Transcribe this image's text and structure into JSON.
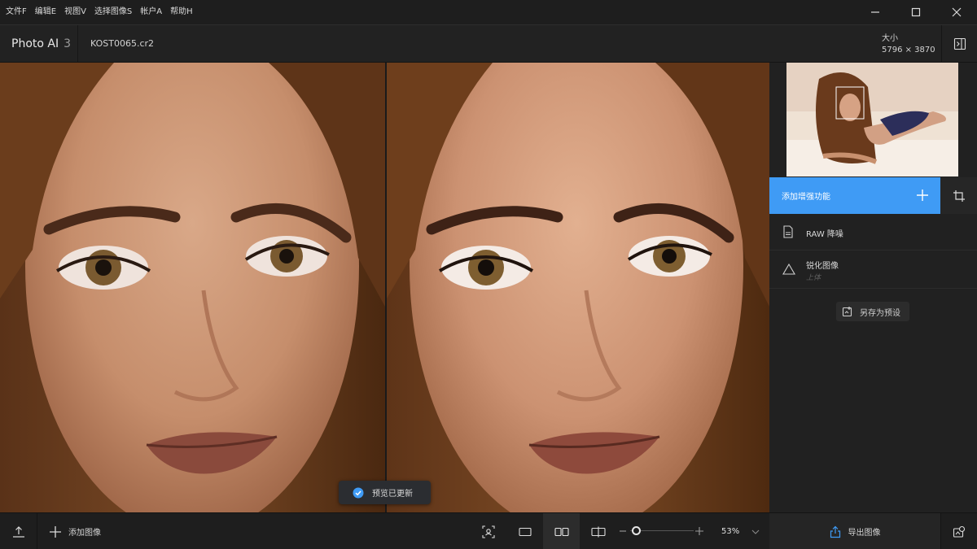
{
  "menu": {
    "items": [
      "文件F",
      "编辑E",
      "视图V",
      "选择图像S",
      "帐户A",
      "帮助H"
    ]
  },
  "window_controls": [
    "minimize-icon",
    "maximize-icon",
    "close-icon"
  ],
  "header": {
    "app_name": "Photo AI",
    "app_version": "3",
    "file_name": "KOST0065.cr2",
    "size_label": "大小",
    "size_value": "5796 × 3870"
  },
  "canvas": {
    "toast_text": "预览已更新"
  },
  "side_panel": {
    "add_enhancement_label": "添加增强功能",
    "modules": [
      {
        "icon": "raw-file-icon",
        "label": "RAW 降噪",
        "sub": ""
      },
      {
        "icon": "triangle-sharpen-icon",
        "label": "锐化图像",
        "sub": "上体"
      }
    ],
    "save_preset_label": "另存为预设"
  },
  "bottom_bar": {
    "add_image_label": "添加图像",
    "view_modes": [
      "face-focus-icon",
      "single-view-icon",
      "side-by-side-icon",
      "split-view-icon"
    ],
    "active_view_mode": "side-by-side-icon",
    "zoom_percent": "53%",
    "export_label": "导出图像"
  },
  "colors": {
    "accent": "#3f9bf5",
    "background": "#1b1b1b",
    "panel": "#212121"
  }
}
